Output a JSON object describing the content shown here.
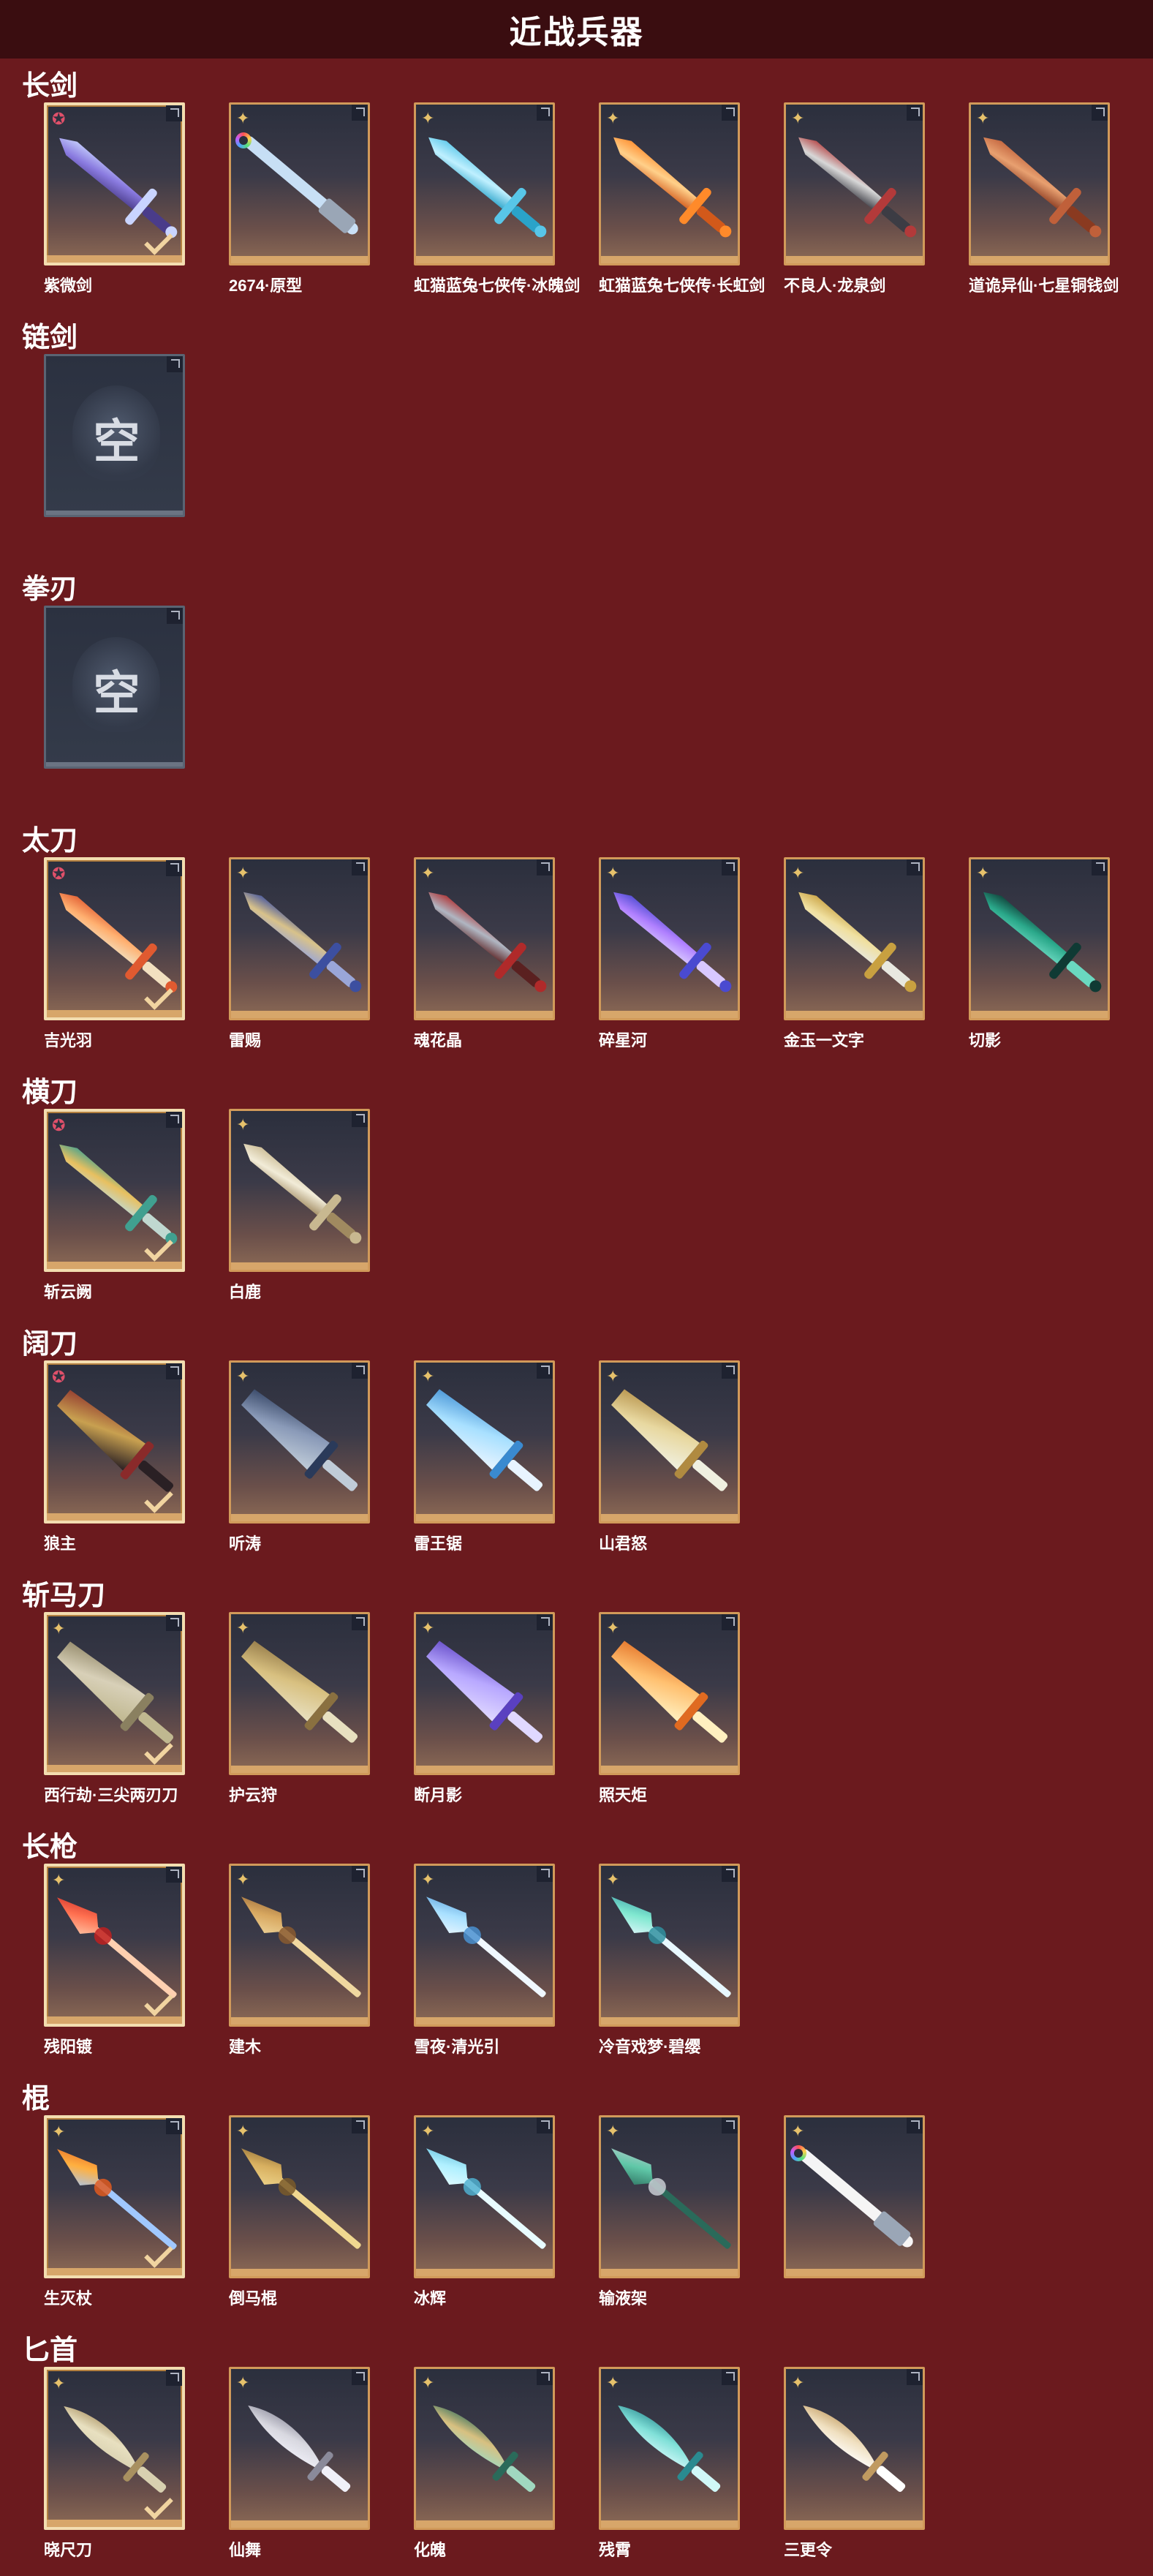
{
  "header": {
    "title": "近战兵器"
  },
  "empty_label": "空",
  "colors": {
    "background": "#6b1a1e",
    "title_bar": "#3a0d10",
    "card_border": "#d19a5a",
    "equipped_border": "#f3ddb0",
    "star_badge": "#e0506a",
    "spark_badge": "#e6c16b"
  },
  "sections": [
    {
      "label": "长剑",
      "items": [
        {
          "name": "紫微剑",
          "badge": "star",
          "equipped": true,
          "colors": [
            "#8a7be0",
            "#c9d4ff",
            "#4a3c8a"
          ],
          "icon": "sword-icon"
        },
        {
          "name": "2674·原型",
          "badge": "spark",
          "ring": true,
          "colors": [
            "#cfe8ff",
            "#6fb6ff",
            "#9aa6b6"
          ],
          "icon": "lightsaber-icon"
        },
        {
          "name": "虹猫蓝兔七侠传·冰魄剑",
          "badge": "spark",
          "colors": [
            "#bff0ff",
            "#58c6e8",
            "#2aa3c9"
          ],
          "icon": "sword-icon"
        },
        {
          "name": "虹猫蓝兔七侠传·长虹剑",
          "badge": "spark",
          "colors": [
            "#ffd08a",
            "#ff8a2a",
            "#d2591a"
          ],
          "icon": "sword-icon"
        },
        {
          "name": "不良人·龙泉剑",
          "badge": "spark",
          "colors": [
            "#d8d8d8",
            "#b33a3a",
            "#3c3c44"
          ],
          "icon": "sword-icon"
        },
        {
          "name": "道诡异仙·七星铜钱剑",
          "badge": "spark",
          "colors": [
            "#e8a070",
            "#c0603a",
            "#8a3a20"
          ],
          "icon": "coin-sword-icon"
        }
      ]
    },
    {
      "label": "链剑",
      "items": [
        {
          "empty": true
        }
      ]
    },
    {
      "label": "拳刃",
      "items": [
        {
          "empty": true
        }
      ]
    },
    {
      "label": "太刀",
      "items": [
        {
          "name": "吉光羽",
          "badge": "star",
          "equipped": true,
          "colors": [
            "#ffb070",
            "#e05a30",
            "#f2e0c0"
          ],
          "icon": "katana-icon"
        },
        {
          "name": "雷赐",
          "badge": "spark",
          "colors": [
            "#d8c28a",
            "#3c4fa0",
            "#9aa6d8"
          ],
          "icon": "katana-icon"
        },
        {
          "name": "魂花晶",
          "badge": "spark",
          "colors": [
            "#b0b6c2",
            "#b02a2a",
            "#5a2020"
          ],
          "icon": "katana-icon"
        },
        {
          "name": "碎星河",
          "badge": "spark",
          "colors": [
            "#b080ff",
            "#4a4ad0",
            "#d8c8ff"
          ],
          "icon": "katana-icon"
        },
        {
          "name": "金玉一文字",
          "badge": "spark",
          "colors": [
            "#f0e0a0",
            "#c8a040",
            "#e8e8e0"
          ],
          "icon": "katana-icon"
        },
        {
          "name": "切影",
          "badge": "spark",
          "colors": [
            "#2aa88a",
            "#0f3a34",
            "#6ad8c0"
          ],
          "icon": "katana-icon"
        }
      ]
    },
    {
      "label": "横刀",
      "items": [
        {
          "name": "斩云阙",
          "badge": "star",
          "equipped": true,
          "colors": [
            "#e8c060",
            "#40a090",
            "#c0d8d0"
          ],
          "icon": "dao-icon"
        },
        {
          "name": "白鹿",
          "badge": "spark",
          "colors": [
            "#f2ecd8",
            "#c8b890",
            "#a08a60"
          ],
          "icon": "dao-icon"
        }
      ]
    },
    {
      "label": "阔刀",
      "items": [
        {
          "name": "狼主",
          "badge": "star",
          "equipped": true,
          "colors": [
            "#c8a050",
            "#8a2a2a",
            "#2a2024"
          ],
          "icon": "broadsword-icon"
        },
        {
          "name": "听涛",
          "badge": "spark",
          "colors": [
            "#8a9ab8",
            "#2a3a5a",
            "#c0ccd8"
          ],
          "icon": "broadsword-icon"
        },
        {
          "name": "雷王锯",
          "badge": "spark",
          "colors": [
            "#a8e0ff",
            "#3a8ad0",
            "#e8f4ff"
          ],
          "icon": "broadsword-icon"
        },
        {
          "name": "山君怒",
          "badge": "spark",
          "colors": [
            "#e8d8a0",
            "#b08a40",
            "#f0f0e0"
          ],
          "icon": "broadsword-icon"
        }
      ]
    },
    {
      "label": "斩马刀",
      "items": [
        {
          "name": "西行劫·三尖两刃刀",
          "badge": "spark",
          "equipped": true,
          "colors": [
            "#d8d0b8",
            "#8a8060",
            "#c0b890"
          ],
          "icon": "glaive-icon"
        },
        {
          "name": "护云狩",
          "badge": "spark",
          "colors": [
            "#d8c080",
            "#8a7040",
            "#e8e0c0"
          ],
          "icon": "glaive-icon"
        },
        {
          "name": "断月影",
          "badge": "spark",
          "colors": [
            "#b8a8ff",
            "#5a40c0",
            "#e0d8ff"
          ],
          "icon": "glaive-icon"
        },
        {
          "name": "照天炬",
          "badge": "spark",
          "colors": [
            "#ffc070",
            "#e06a20",
            "#fff0c0"
          ],
          "icon": "glaive-icon"
        }
      ]
    },
    {
      "label": "长枪",
      "items": [
        {
          "name": "残阳镀",
          "badge": "spark",
          "equipped": true,
          "colors": [
            "#ff7050",
            "#c02020",
            "#ffd0b0"
          ],
          "icon": "spear-icon"
        },
        {
          "name": "建木",
          "badge": "spark",
          "colors": [
            "#d8a860",
            "#8a5a30",
            "#f0d8a0"
          ],
          "icon": "spear-icon"
        },
        {
          "name": "雪夜·清光引",
          "badge": "spark",
          "colors": [
            "#a8e0ff",
            "#4a90d0",
            "#f0f8ff"
          ],
          "icon": "spear-icon"
        },
        {
          "name": "冷音戏梦·碧缨",
          "badge": "spark",
          "colors": [
            "#80e8d0",
            "#3090a0",
            "#e8f8ff"
          ],
          "icon": "spear-icon"
        }
      ]
    },
    {
      "label": "棍",
      "items": [
        {
          "name": "生灭杖",
          "badge": "spark",
          "equipped": true,
          "colors": [
            "#ffb040",
            "#e05a20",
            "#a0c8ff"
          ],
          "icon": "staff-icon"
        },
        {
          "name": "倒马棍",
          "badge": "spark",
          "colors": [
            "#d8b060",
            "#7a5a2a",
            "#f0d890"
          ],
          "icon": "staff-icon"
        },
        {
          "name": "冰辉",
          "badge": "spark",
          "colors": [
            "#b0f0ff",
            "#50b0d0",
            "#e8fcff"
          ],
          "icon": "staff-icon"
        },
        {
          "name": "输液架",
          "badge": "spark",
          "colors": [
            "#60c8a8",
            "#c8ccd4",
            "#2a6a5a"
          ],
          "icon": "iv-stand-icon"
        },
        {
          "name": "",
          "badge": "spark",
          "ring": true,
          "colors": [
            "#ffffff",
            "#cfd8e8",
            "#9aa6b6"
          ],
          "icon": "light-staff-icon"
        }
      ]
    },
    {
      "label": "匕首",
      "items": [
        {
          "name": "晓尺刀",
          "badge": "spark",
          "equipped": true,
          "colors": [
            "#e8e0c0",
            "#a89060",
            "#d8d0b0"
          ],
          "icon": "dagger-icon"
        },
        {
          "name": "仙舞",
          "badge": "spark",
          "colors": [
            "#d8d8e0",
            "#8a8a9a",
            "#f0f0f8"
          ],
          "icon": "dagger-icon"
        },
        {
          "name": "化魄",
          "badge": "spark",
          "colors": [
            "#d8c080",
            "#2a6a5a",
            "#a0d8c0"
          ],
          "icon": "dagger-icon"
        },
        {
          "name": "残霄",
          "badge": "spark",
          "colors": [
            "#80e0d8",
            "#2a8a90",
            "#d0f8f8"
          ],
          "icon": "dagger-icon"
        },
        {
          "name": "三更令",
          "badge": "spark",
          "colors": [
            "#f0e0c0",
            "#c09a60",
            "#ffffff"
          ],
          "icon": "dagger-icon"
        }
      ]
    }
  ]
}
